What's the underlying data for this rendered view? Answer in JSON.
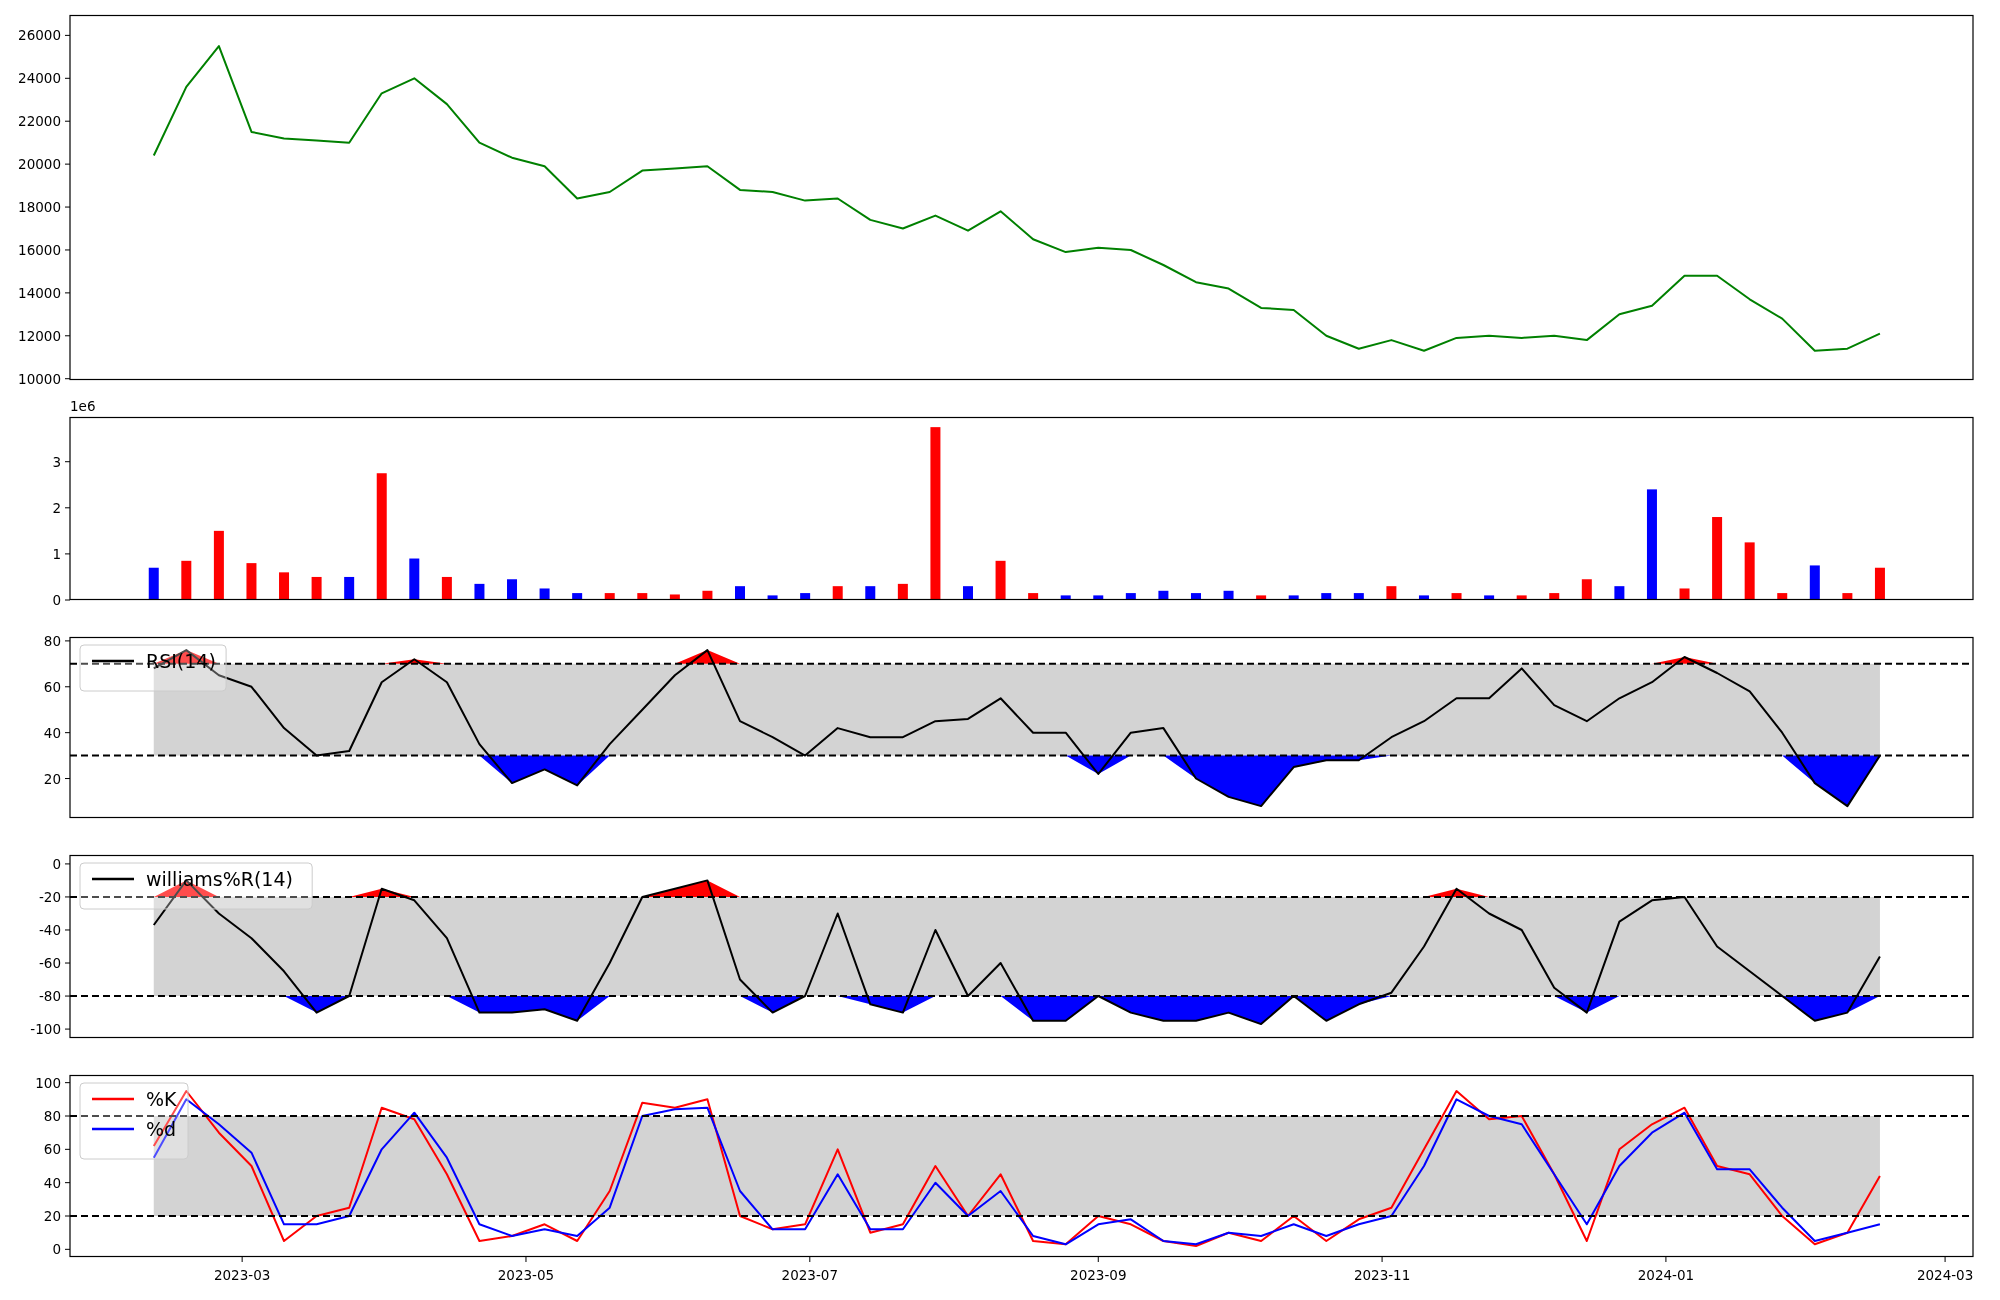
{
  "panels": [
    {
      "chart_data": {
        "type": "line",
        "xlim": [
          "2023-01-23",
          "2024-03-07"
        ],
        "ylim": [
          9940,
          26950
        ],
        "yticks": [
          10000,
          12000,
          14000,
          16000,
          18000,
          20000,
          22000,
          24000,
          26000
        ],
        "x": [
          "2023-02-10",
          "2023-02-17",
          "2023-02-24",
          "2023-03-03",
          "2023-03-10",
          "2023-03-17",
          "2023-03-24",
          "2023-03-31",
          "2023-04-07",
          "2023-04-14",
          "2023-04-21",
          "2023-04-28",
          "2023-05-05",
          "2023-05-12",
          "2023-05-19",
          "2023-05-26",
          "2023-06-02",
          "2023-06-09",
          "2023-06-16",
          "2023-06-23",
          "2023-06-30",
          "2023-07-07",
          "2023-07-14",
          "2023-07-21",
          "2023-07-28",
          "2023-08-04",
          "2023-08-11",
          "2023-08-18",
          "2023-08-25",
          "2023-09-01",
          "2023-09-08",
          "2023-09-15",
          "2023-09-22",
          "2023-09-29",
          "2023-10-06",
          "2023-10-13",
          "2023-10-20",
          "2023-10-27",
          "2023-11-03",
          "2023-11-10",
          "2023-11-17",
          "2023-11-24",
          "2023-12-01",
          "2023-12-08",
          "2023-12-15",
          "2023-12-22",
          "2023-12-29",
          "2024-01-05",
          "2024-01-12",
          "2024-01-19",
          "2024-01-26",
          "2024-02-02",
          "2024-02-09",
          "2024-02-16"
        ],
        "series": [
          {
            "color": "#008000",
            "values": [
              20400,
              23600,
              25500,
              21500,
              21200,
              21100,
              21000,
              23300,
              24000,
              22800,
              21000,
              20300,
              19900,
              18400,
              18700,
              19700,
              19800,
              19900,
              18800,
              18700,
              18300,
              18400,
              17400,
              17000,
              17600,
              16900,
              17800,
              16500,
              15900,
              16100,
              16000,
              15300,
              14500,
              14200,
              13300,
              13200,
              12000,
              11400,
              11800,
              11300,
              11900,
              12000,
              11900,
              12000,
              11800,
              13000,
              13400,
              14800,
              14800,
              13700,
              12800,
              11300,
              11400,
              12100
            ]
          }
        ]
      }
    },
    {
      "scale_label": "1e6",
      "chart_data": {
        "type": "bar",
        "xlim": [
          "2023-01-23",
          "2024-03-07"
        ],
        "ylim": [
          0,
          3.97
        ],
        "yticks": [
          0,
          1,
          2,
          3
        ],
        "x": [
          "2023-02-10",
          "2023-02-17",
          "2023-02-24",
          "2023-03-03",
          "2023-03-10",
          "2023-03-17",
          "2023-03-24",
          "2023-03-31",
          "2023-04-07",
          "2023-04-14",
          "2023-04-21",
          "2023-04-28",
          "2023-05-05",
          "2023-05-12",
          "2023-05-19",
          "2023-05-26",
          "2023-06-02",
          "2023-06-09",
          "2023-06-16",
          "2023-06-23",
          "2023-06-30",
          "2023-07-07",
          "2023-07-14",
          "2023-07-21",
          "2023-07-28",
          "2023-08-04",
          "2023-08-11",
          "2023-08-18",
          "2023-08-25",
          "2023-09-01",
          "2023-09-08",
          "2023-09-15",
          "2023-09-22",
          "2023-09-29",
          "2023-10-06",
          "2023-10-13",
          "2023-10-20",
          "2023-10-27",
          "2023-11-03",
          "2023-11-10",
          "2023-11-17",
          "2023-11-24",
          "2023-12-01",
          "2023-12-08",
          "2023-12-15",
          "2023-12-22",
          "2023-12-29",
          "2024-01-05",
          "2024-01-12",
          "2024-01-19",
          "2024-01-26",
          "2024-02-02",
          "2024-02-09",
          "2024-02-16"
        ],
        "series": [
          {
            "color": "#ff0000",
            "values": [
              null,
              0.85,
              1.5,
              0.8,
              0.6,
              0.5,
              null,
              2.75,
              null,
              0.5,
              null,
              null,
              null,
              null,
              0.15,
              0.15,
              0.12,
              0.2,
              null,
              null,
              null,
              0.3,
              null,
              0.35,
              3.75,
              null,
              0.85,
              0.15,
              null,
              null,
              null,
              null,
              null,
              null,
              0.1,
              null,
              null,
              null,
              0.3,
              null,
              0.15,
              null,
              0.1,
              0.15,
              0.45,
              null,
              null,
              0.25,
              1.8,
              1.25,
              0.15,
              null,
              0.15,
              0.7
            ]
          },
          {
            "color": "#0000ff",
            "values": [
              0.7,
              null,
              null,
              null,
              null,
              null,
              0.5,
              null,
              0.9,
              null,
              0.35,
              0.45,
              0.25,
              0.15,
              null,
              null,
              null,
              null,
              0.3,
              0.1,
              0.15,
              null,
              0.3,
              null,
              null,
              0.3,
              null,
              null,
              0.1,
              0.1,
              0.15,
              0.2,
              0.15,
              0.2,
              null,
              0.1,
              0.15,
              0.15,
              null,
              0.1,
              null,
              0.1,
              null,
              null,
              null,
              0.3,
              2.4,
              null,
              null,
              null,
              null,
              0.75,
              null,
              null
            ]
          }
        ]
      }
    },
    {
      "chart_data": {
        "type": "line",
        "legend": "upper left",
        "xlim": [
          "2023-01-23",
          "2024-03-07"
        ],
        "ylim": [
          2.8,
          81.7
        ],
        "yticks": [
          20,
          40,
          60,
          80
        ],
        "x": [
          "2023-02-10",
          "2023-02-17",
          "2023-02-24",
          "2023-03-03",
          "2023-03-10",
          "2023-03-17",
          "2023-03-24",
          "2023-03-31",
          "2023-04-07",
          "2023-04-14",
          "2023-04-21",
          "2023-04-28",
          "2023-05-05",
          "2023-05-12",
          "2023-05-19",
          "2023-05-26",
          "2023-06-02",
          "2023-06-09",
          "2023-06-16",
          "2023-06-23",
          "2023-06-30",
          "2023-07-07",
          "2023-07-14",
          "2023-07-21",
          "2023-07-28",
          "2023-08-04",
          "2023-08-11",
          "2023-08-18",
          "2023-08-25",
          "2023-09-01",
          "2023-09-08",
          "2023-09-15",
          "2023-09-22",
          "2023-09-29",
          "2023-10-06",
          "2023-10-13",
          "2023-10-20",
          "2023-10-27",
          "2023-11-03",
          "2023-11-10",
          "2023-11-17",
          "2023-11-24",
          "2023-12-01",
          "2023-12-08",
          "2023-12-15",
          "2023-12-22",
          "2023-12-29",
          "2024-01-05",
          "2024-01-12",
          "2024-01-19",
          "2024-01-26",
          "2024-02-02",
          "2024-02-09",
          "2024-02-16"
        ],
        "series": [
          {
            "name": "RSI(14)",
            "color": "#000000",
            "values": [
              68,
              76,
              65,
              60,
              42,
              30,
              32,
              62,
              72,
              62,
              35,
              18,
              24,
              17,
              35,
              50,
              65,
              76,
              45,
              38,
              30,
              42,
              38,
              38,
              45,
              46,
              55,
              40,
              40,
              22,
              40,
              42,
              20,
              12,
              8,
              25,
              28,
              28,
              38,
              45,
              55,
              55,
              68,
              52,
              45,
              55,
              62,
              73,
              66,
              58,
              40,
              18,
              8,
              30
            ]
          },
          {
            "type": "area",
            "color": "#ff0000",
            "values": [
              70,
              76,
              70,
              null,
              null,
              null,
              null,
              70,
              72,
              70,
              null,
              null,
              null,
              null,
              null,
              null,
              70,
              76,
              70,
              null,
              null,
              null,
              null,
              null,
              null,
              null,
              null,
              null,
              null,
              null,
              null,
              null,
              null,
              null,
              null,
              null,
              null,
              null,
              null,
              null,
              null,
              null,
              null,
              null,
              null,
              null,
              70,
              73,
              70,
              null,
              null,
              null,
              null,
              null
            ]
          },
          {
            "type": "area",
            "color": "#0000ff",
            "values": [
              null,
              null,
              null,
              null,
              null,
              null,
              null,
              null,
              null,
              null,
              30,
              18,
              24,
              17,
              30,
              null,
              null,
              null,
              null,
              null,
              null,
              null,
              null,
              null,
              null,
              null,
              null,
              null,
              30,
              22,
              30,
              30,
              20,
              12,
              8,
              25,
              28,
              28,
              30,
              null,
              null,
              null,
              null,
              null,
              null,
              null,
              null,
              null,
              null,
              null,
              30,
              18,
              8,
              30
            ]
          }
        ],
        "bands": [
          {
            "axis": "y",
            "from": 30,
            "to": 70,
            "color": "#d3d3d3"
          }
        ],
        "ref_lines": [
          {
            "axis": "y",
            "value": 70
          },
          {
            "axis": "y",
            "value": 30
          }
        ]
      }
    },
    {
      "chart_data": {
        "type": "line",
        "legend": "upper left",
        "xlim": [
          "2023-01-23",
          "2024-03-07"
        ],
        "ylim": [
          -105.4,
          5.4
        ],
        "yticks": [
          -100,
          -80,
          -60,
          -40,
          -20,
          0
        ],
        "x": [
          "2023-02-10",
          "2023-02-17",
          "2023-02-24",
          "2023-03-03",
          "2023-03-10",
          "2023-03-17",
          "2023-03-24",
          "2023-03-31",
          "2023-04-07",
          "2023-04-14",
          "2023-04-21",
          "2023-04-28",
          "2023-05-05",
          "2023-05-12",
          "2023-05-19",
          "2023-05-26",
          "2023-06-02",
          "2023-06-09",
          "2023-06-16",
          "2023-06-23",
          "2023-06-30",
          "2023-07-07",
          "2023-07-14",
          "2023-07-21",
          "2023-07-28",
          "2023-08-04",
          "2023-08-11",
          "2023-08-18",
          "2023-08-25",
          "2023-09-01",
          "2023-09-08",
          "2023-09-15",
          "2023-09-22",
          "2023-09-29",
          "2023-10-06",
          "2023-10-13",
          "2023-10-20",
          "2023-10-27",
          "2023-11-03",
          "2023-11-10",
          "2023-11-17",
          "2023-11-24",
          "2023-12-01",
          "2023-12-08",
          "2023-12-15",
          "2023-12-22",
          "2023-12-29",
          "2024-01-05",
          "2024-01-12",
          "2024-01-19",
          "2024-01-26",
          "2024-02-02",
          "2024-02-09",
          "2024-02-16"
        ],
        "series": [
          {
            "name": "williams%R(14)",
            "color": "#000000",
            "values": [
              -37,
              -10,
              -30,
              -45,
              -65,
              -90,
              -80,
              -15,
              -22,
              -45,
              -90,
              -90,
              -88,
              -95,
              -60,
              -20,
              -15,
              -10,
              -70,
              -90,
              -80,
              -30,
              -85,
              -90,
              -40,
              -80,
              -60,
              -95,
              -95,
              -80,
              -90,
              -95,
              -95,
              -90,
              -97,
              -80,
              -95,
              -85,
              -78,
              -50,
              -15,
              -30,
              -40,
              -75,
              -90,
              -35,
              -22,
              -20,
              -50,
              -65,
              -80,
              -95,
              -90,
              -56
            ]
          },
          {
            "type": "area",
            "color": "#ff0000",
            "values": [
              -20,
              -10,
              -20,
              null,
              null,
              null,
              -20,
              -15,
              -20,
              null,
              null,
              null,
              null,
              null,
              null,
              -20,
              -15,
              -10,
              -20,
              null,
              null,
              null,
              null,
              null,
              null,
              null,
              null,
              null,
              null,
              null,
              null,
              null,
              null,
              null,
              null,
              null,
              null,
              null,
              null,
              -20,
              -15,
              -20,
              null,
              null,
              null,
              null,
              null,
              null,
              null,
              null,
              null,
              null,
              null,
              null
            ]
          },
          {
            "type": "area",
            "color": "#0000ff",
            "values": [
              null,
              null,
              null,
              null,
              -80,
              -90,
              -80,
              null,
              null,
              -80,
              -90,
              -90,
              -88,
              -95,
              -80,
              null,
              null,
              null,
              -80,
              -90,
              -80,
              -80,
              -85,
              -90,
              -80,
              null,
              -80,
              -95,
              -95,
              -80,
              -90,
              -95,
              -95,
              -90,
              -97,
              -80,
              -95,
              -85,
              -80,
              null,
              null,
              null,
              null,
              -80,
              -90,
              -80,
              null,
              null,
              null,
              -80,
              -80,
              -95,
              -90,
              -80
            ]
          }
        ],
        "bands": [
          {
            "axis": "y",
            "from": -80,
            "to": -20,
            "color": "#d3d3d3"
          }
        ],
        "ref_lines": [
          {
            "axis": "y",
            "value": -20
          },
          {
            "axis": "y",
            "value": -80
          }
        ]
      }
    },
    {
      "chart_data": {
        "type": "line",
        "legend": "upper left",
        "xlim": [
          "2023-01-23",
          "2024-03-07"
        ],
        "ylim": [
          -4.6,
          104.6
        ],
        "yticks": [
          0,
          20,
          40,
          60,
          80,
          100
        ],
        "xticks": [
          {
            "value": "2023-03-01",
            "label": "2023-03"
          },
          {
            "value": "2023-05-01",
            "label": "2023-05"
          },
          {
            "value": "2023-07-01",
            "label": "2023-07"
          },
          {
            "value": "2023-09-01",
            "label": "2023-09"
          },
          {
            "value": "2023-11-01",
            "label": "2023-11"
          },
          {
            "value": "2024-01-01",
            "label": "2024-01"
          },
          {
            "value": "2024-03-01",
            "label": "2024-03"
          }
        ],
        "x": [
          "2023-02-10",
          "2023-02-17",
          "2023-02-24",
          "2023-03-03",
          "2023-03-10",
          "2023-03-17",
          "2023-03-24",
          "2023-03-31",
          "2023-04-07",
          "2023-04-14",
          "2023-04-21",
          "2023-04-28",
          "2023-05-05",
          "2023-05-12",
          "2023-05-19",
          "2023-05-26",
          "2023-06-02",
          "2023-06-09",
          "2023-06-16",
          "2023-06-23",
          "2023-06-30",
          "2023-07-07",
          "2023-07-14",
          "2023-07-21",
          "2023-07-28",
          "2023-08-04",
          "2023-08-11",
          "2023-08-18",
          "2023-08-25",
          "2023-09-01",
          "2023-09-08",
          "2023-09-15",
          "2023-09-22",
          "2023-09-29",
          "2023-10-06",
          "2023-10-13",
          "2023-10-20",
          "2023-10-27",
          "2023-11-03",
          "2023-11-10",
          "2023-11-17",
          "2023-11-24",
          "2023-12-01",
          "2023-12-08",
          "2023-12-15",
          "2023-12-22",
          "2023-12-29",
          "2024-01-05",
          "2024-01-12",
          "2024-01-19",
          "2024-01-26",
          "2024-02-02",
          "2024-02-09",
          "2024-02-16"
        ],
        "series": [
          {
            "name": "%K",
            "color": "#ff0000",
            "values": [
              62,
              95,
              70,
              50,
              5,
              20,
              25,
              85,
              78,
              45,
              5,
              8,
              15,
              5,
              35,
              88,
              85,
              90,
              20,
              12,
              15,
              60,
              10,
              15,
              50,
              20,
              45,
              5,
              3,
              20,
              15,
              5,
              2,
              10,
              5,
              20,
              5,
              18,
              25,
              60,
              95,
              78,
              80,
              45,
              5,
              60,
              75,
              85,
              50,
              45,
              20,
              3,
              10,
              44
            ]
          },
          {
            "name": "%d",
            "color": "#0000ff",
            "values": [
              55,
              90,
              75,
              58,
              15,
              15,
              20,
              60,
              82,
              55,
              15,
              8,
              12,
              8,
              25,
              80,
              84,
              85,
              35,
              12,
              12,
              45,
              12,
              12,
              40,
              20,
              35,
              8,
              3,
              15,
              18,
              5,
              3,
              10,
              8,
              15,
              8,
              15,
              20,
              50,
              90,
              80,
              75,
              45,
              15,
              50,
              70,
              82,
              48,
              48,
              25,
              5,
              10,
              15
            ]
          }
        ],
        "bands": [
          {
            "axis": "y",
            "from": 20,
            "to": 80,
            "color": "#d3d3d3"
          }
        ],
        "ref_lines": [
          {
            "axis": "y",
            "value": 80
          },
          {
            "axis": "y",
            "value": 20
          }
        ]
      }
    }
  ]
}
